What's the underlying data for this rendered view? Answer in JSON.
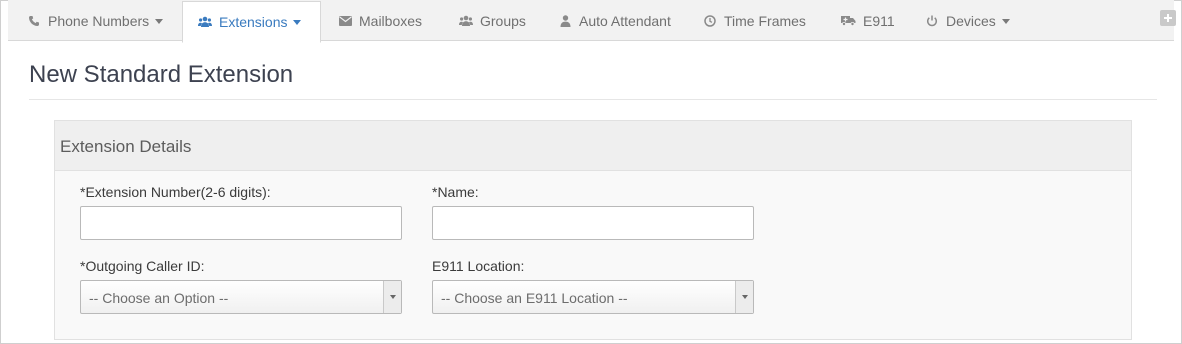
{
  "nav": {
    "tabs": [
      {
        "label": "Phone Numbers",
        "icon": "phone-icon",
        "dropdown": true,
        "active": false
      },
      {
        "label": "Extensions",
        "icon": "users-icon",
        "dropdown": true,
        "active": true
      },
      {
        "label": "Mailboxes",
        "icon": "envelope-icon",
        "dropdown": false,
        "active": false
      },
      {
        "label": "Groups",
        "icon": "group-icon",
        "dropdown": false,
        "active": false
      },
      {
        "label": "Auto Attendant",
        "icon": "user-icon",
        "dropdown": false,
        "active": false
      },
      {
        "label": "Time Frames",
        "icon": "clock-icon",
        "dropdown": false,
        "active": false
      },
      {
        "label": "E911",
        "icon": "ambulance-icon",
        "dropdown": false,
        "active": false
      },
      {
        "label": "Devices",
        "icon": "power-icon",
        "dropdown": true,
        "active": false
      }
    ],
    "add_icon": "plus-square-icon"
  },
  "page": {
    "title": "New Standard Extension"
  },
  "panel": {
    "title": "Extension Details",
    "fields": {
      "extension_number": {
        "label": "*Extension Number(2-6 digits):",
        "value": ""
      },
      "name": {
        "label": "*Name:",
        "value": ""
      },
      "outgoing_caller_id": {
        "label": "*Outgoing Caller ID:",
        "selected": "-- Choose an Option --"
      },
      "e911_location": {
        "label": "E911 Location:",
        "selected": "-- Choose an E911 Location --"
      }
    }
  },
  "colors": {
    "active_tab": "#3a7bbf",
    "tab_text": "#707070",
    "nav_bg": "#f2f2f2"
  }
}
